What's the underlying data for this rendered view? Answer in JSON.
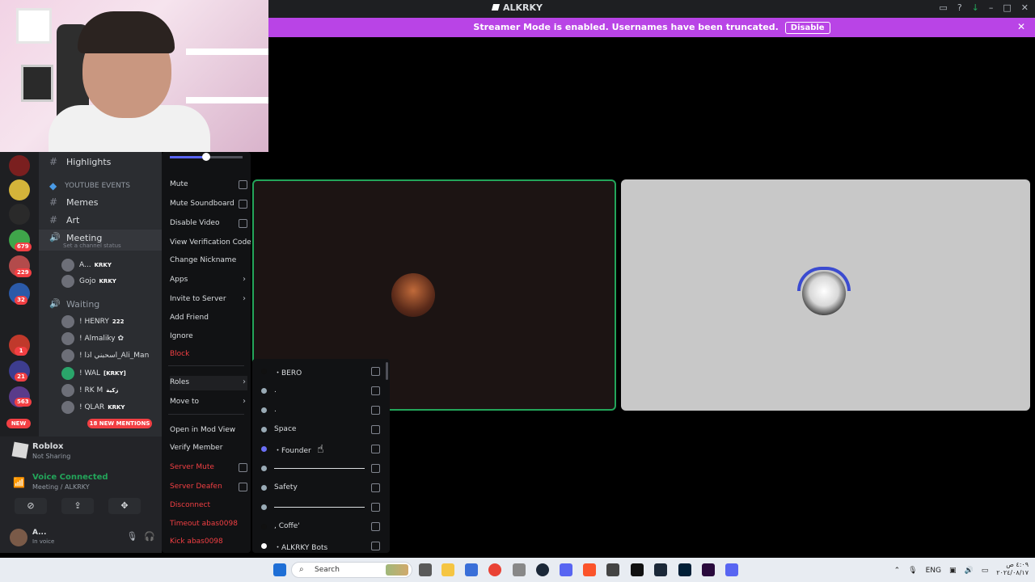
{
  "titlebar": {
    "title": "ALKRKY"
  },
  "banner": {
    "message": "Streamer Mode is enabled. Usernames have been truncated.",
    "disable_label": "Disable"
  },
  "rail": {
    "badges": [
      "679",
      "229",
      "32",
      "1",
      "21",
      "563"
    ],
    "new_label": "NEW"
  },
  "channels": {
    "highlights": "Highlights",
    "category_youtube": "YOUTUBE EVENTS",
    "memes": "Memes",
    "art": "Art",
    "meeting": "Meeting",
    "meeting_status": "Set a channel status",
    "waiting": "Waiting",
    "mentions": "18 NEW MENTIONS"
  },
  "members": [
    {
      "name": "A...",
      "tag": "KRKY"
    },
    {
      "name": "Gojo",
      "tag": "KRKY"
    },
    {
      "name": "! HENRY",
      "tag": "222"
    },
    {
      "name": "! Almaliky ✿",
      "tag": ""
    },
    {
      "name": "! اسحبني اذا_Ali_Man",
      "tag": ""
    },
    {
      "name": "! WAL",
      "tag": "[KRKY]"
    },
    {
      "name": "! RK M",
      "tag": "زكية"
    },
    {
      "name": "! QLAR",
      "tag": "KRKY"
    }
  ],
  "activity": {
    "name": "Roblox",
    "status": "Not Sharing"
  },
  "voice": {
    "status": "Voice Connected",
    "location": "Meeting / ALKRKY"
  },
  "user": {
    "name": "A...",
    "status": "In voice"
  },
  "context_menu": {
    "volume_fraction": 0.5,
    "mute": "Mute",
    "mute_soundboard": "Mute Soundboard",
    "disable_video": "Disable Video",
    "view_verification_code": "View Verification Code",
    "change_nickname": "Change Nickname",
    "apps": "Apps",
    "invite_to_server": "Invite to Server",
    "add_friend": "Add Friend",
    "ignore": "Ignore",
    "block": "Block",
    "roles": "Roles",
    "move_to": "Move to",
    "open_in_mod_view": "Open in Mod View",
    "verify_member": "Verify Member",
    "server_mute": "Server Mute",
    "server_deafen": "Server Deafen",
    "disconnect": "Disconnect",
    "timeout": "Timeout abas0098",
    "kick": "Kick abas0098"
  },
  "roles": [
    {
      "name": "・BERO",
      "color": "#111111"
    },
    {
      "name": ".",
      "color": "#99aab5"
    },
    {
      "name": ".",
      "color": "#99aab5"
    },
    {
      "name": "Space",
      "color": "#99aab5"
    },
    {
      "name": "・Founder",
      "color": "#6b6ff5"
    },
    {
      "name": "",
      "color": "#99aab5"
    },
    {
      "name": "Safety",
      "color": "#99aab5"
    },
    {
      "name": "",
      "color": "#99aab5"
    },
    {
      "name": ", Coffe'",
      "color": "#111111"
    },
    {
      "name": "・ALKRKY Bots",
      "color": "#ffffff"
    }
  ],
  "taskbar": {
    "search": "Search",
    "lang": "ENG",
    "time": "٤:٠٩ ص",
    "date": "٢٠٢٤/٠٨/١٧"
  }
}
